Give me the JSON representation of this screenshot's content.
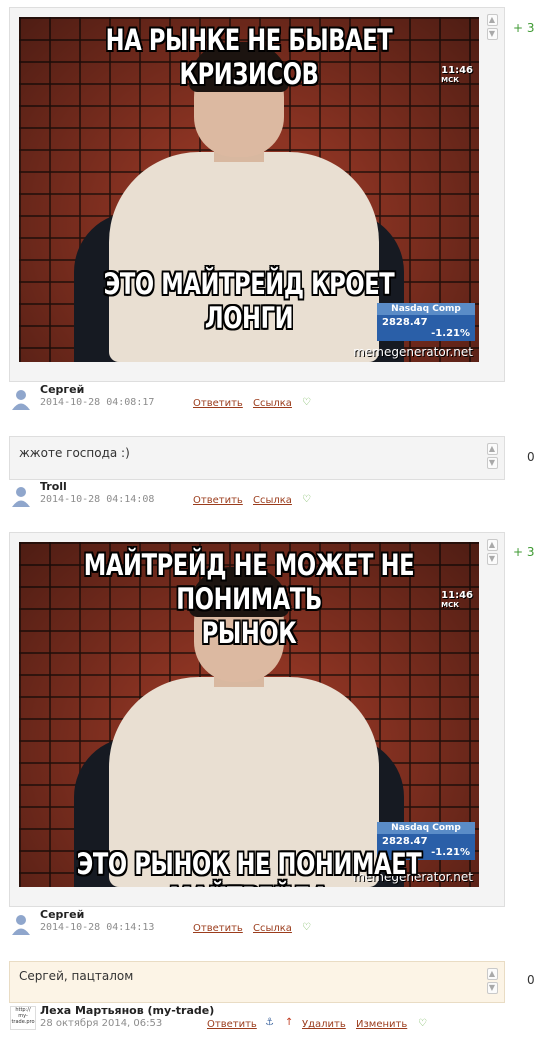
{
  "comments": [
    {
      "meme_top": "НА РЫНКЕ НЕ БЫВАЕТ\nКРИЗИСОВ",
      "meme_bottom": "ЭТО МАЙТРЕЙД КРОЕТ\nЛОНГИ",
      "score": "+ 3",
      "author": "Сергей",
      "date": "2014-10-28 04:08:17",
      "reply": "Ответить",
      "link": "Ссылка"
    },
    {
      "text": "жжоте господа :)",
      "score": "0",
      "author": "Troll",
      "date": "2014-10-28 04:14:08",
      "reply": "Ответить",
      "link": "Ссылка"
    },
    {
      "meme_top": "МАЙТРЕЙД НЕ МОЖЕТ НЕ ПОНИМАТЬ\nРЫНОК",
      "meme_bottom": "ЭТО РЫНОК НЕ ПОНИМАЕТ МАЙТРЕЙДА",
      "score": "+ 3",
      "author": "Сергей",
      "date": "2014-10-28 04:14:13",
      "reply": "Ответить",
      "link": "Ссылка"
    },
    {
      "text": "Сергей, пацталом",
      "score": "0",
      "author": "Леха Мартьянов (my-trade)",
      "date": "28 октября 2014, 06:53",
      "reply": "Ответить",
      "delete": "Удалить",
      "edit": "Изменить"
    }
  ],
  "meme_overlay": {
    "clock": "11:46",
    "clock_sub": "МСК",
    "ticker_label": "Nasdaq Comp",
    "ticker_value": "2828.47",
    "ticker_change": "-1.21%",
    "watermark": "memegenerator.net"
  },
  "logo_text": "http:// my-trade.pro",
  "icons": {
    "vote_up": "up-arrow-icon",
    "vote_down": "down-arrow-icon",
    "heart": "heart-icon",
    "avatar": "user-avatar-icon"
  },
  "colors": {
    "positive_score": "#3f9a33",
    "link": "#9b3c1c",
    "heart": "#6ab04c",
    "highlight_bg": "#fcf4e6"
  }
}
